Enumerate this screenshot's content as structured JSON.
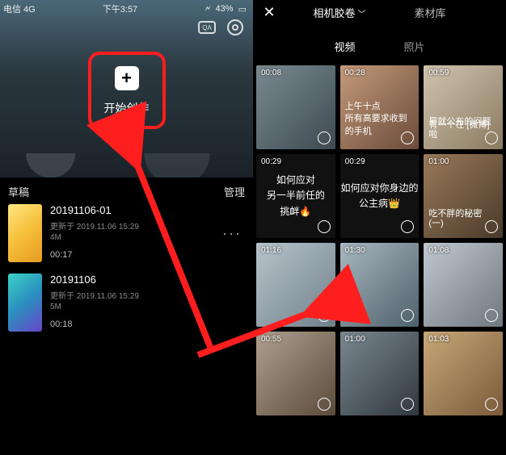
{
  "statusbar": {
    "carrier": "电信 4G",
    "time": "下午3:57",
    "battery": "43%"
  },
  "create": {
    "label": "开始创作",
    "plus": "+"
  },
  "draft_header": {
    "title": "草稿",
    "manage": "管理"
  },
  "drafts": [
    {
      "title": "20191106-01",
      "sub": "更新于 2019.11.06 15:29",
      "size": "4M",
      "dur": "00:17"
    },
    {
      "title": "20191106",
      "sub": "更新于 2019.11.06 15:29",
      "size": "5M",
      "dur": "00:18"
    }
  ],
  "more": "···",
  "right_tabs": {
    "roll": "相机胶卷",
    "lib": "素材库",
    "chev": "﹀"
  },
  "sub_tabs": {
    "video": "视频",
    "photo": "照片"
  },
  "clips": [
    {
      "dur": "00:08",
      "bg": "bg-a"
    },
    {
      "dur": "00:28",
      "bg": "bg-b",
      "caption1": "上午十点",
      "caption2": "所有高要求收到的手机"
    },
    {
      "dur": "00:59",
      "bg": "bg-c",
      "caption_red1": "有一个在 [微博]",
      "caption_red2": "早就公布的问题啦"
    },
    {
      "dur": "00:29",
      "bg": "bg-e",
      "text1": "如何应对",
      "text2": "另一半前任的",
      "text3": "挑衅🔥"
    },
    {
      "dur": "00:29",
      "bg": "bg-e",
      "text1": "如何应对你身边的",
      "text2": "公主病👑"
    },
    {
      "dur": "01:00",
      "bg": "bg-d",
      "caption_red1": "吃不胖的秘密",
      "caption_red2": "(一)"
    },
    {
      "dur": "01:16",
      "bg": "bg-f"
    },
    {
      "dur": "01:30",
      "bg": "bg-g"
    },
    {
      "dur": "01:08",
      "bg": "bg-h"
    },
    {
      "dur": "00:55",
      "bg": "bg-i"
    },
    {
      "dur": "01:00",
      "bg": "bg-j"
    },
    {
      "dur": "01:03",
      "bg": "bg-k"
    }
  ]
}
